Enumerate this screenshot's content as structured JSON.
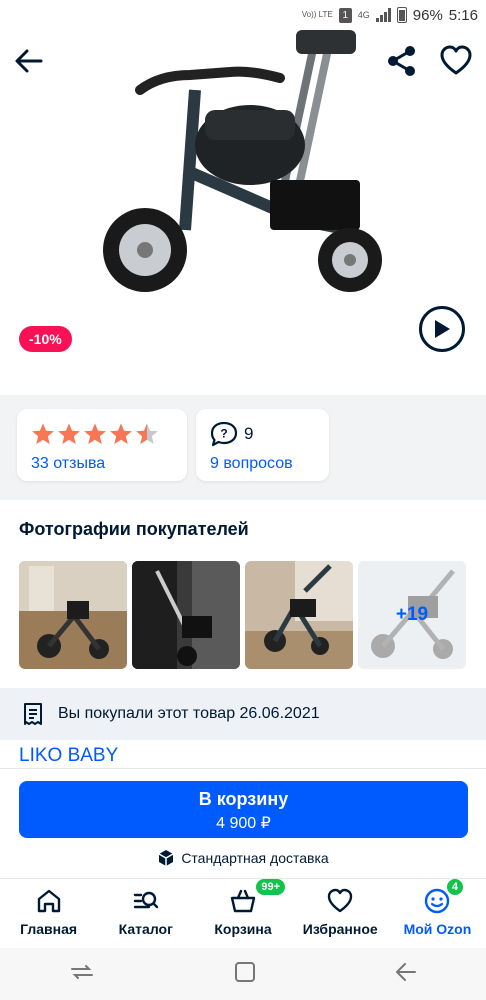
{
  "status_bar": {
    "volte": "Vo)) LTE",
    "sim": "1",
    "network": "4G",
    "battery": "96%",
    "time": "5:16"
  },
  "product": {
    "discount_badge": "-10%",
    "brand": "LIKO BABY"
  },
  "rating": {
    "value": 4.5,
    "stars_max": 5,
    "reviews_link": "33 отзыва",
    "questions_count": "9",
    "questions_link": "9 вопросов"
  },
  "buyer_photos": {
    "title": "Фотографии покупателей",
    "more": "+19"
  },
  "purchase_info": {
    "text": "Вы покупали этот товар 26.06.2021"
  },
  "cart": {
    "button_label": "В корзину",
    "price": "4 900 ₽",
    "delivery": "Стандартная доставка"
  },
  "tabbar": {
    "home": "Главная",
    "catalog": "Каталог",
    "cart": "Корзина",
    "cart_badge": "99+",
    "favorites": "Избранное",
    "profile": "Мой Ozon",
    "profile_badge": "4"
  },
  "colors": {
    "accent": "#005bff",
    "discount": "#f91155",
    "badge": "#10c44c",
    "star": "#f97655"
  }
}
